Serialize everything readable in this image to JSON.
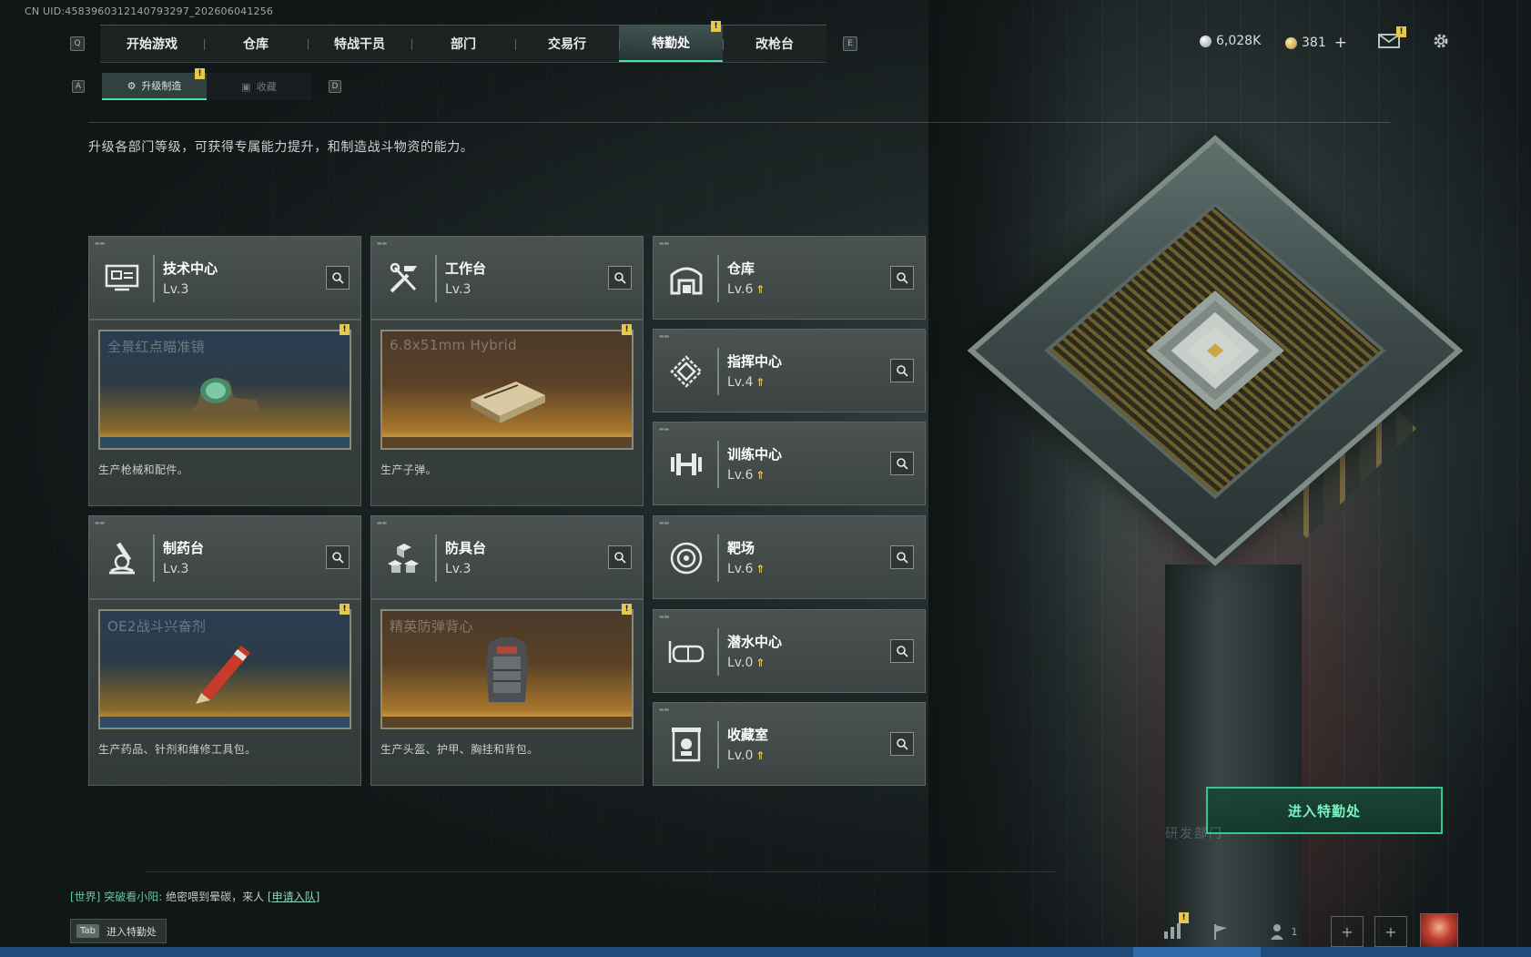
{
  "uid": "CN UID:4583960312140793297_202606041256",
  "nav": {
    "tabs": [
      {
        "label": "开始游戏"
      },
      {
        "label": "仓库"
      },
      {
        "label": "特战干员"
      },
      {
        "label": "部门"
      },
      {
        "label": "交易行"
      },
      {
        "label": "特勤处",
        "active": true,
        "badge": "!"
      },
      {
        "label": "改枪台"
      }
    ],
    "left_key": "Q",
    "right_key": "E"
  },
  "subnav": {
    "left_key": "A",
    "right_key": "D",
    "tabs": [
      {
        "label": "升级制造",
        "active": true,
        "badge": "!"
      },
      {
        "label": "收藏",
        "active": false
      }
    ]
  },
  "description": "升级各部门等级，可获得专属能力提升，和制造战斗物资的能力。",
  "currency": {
    "silver": "6,028K",
    "gold": "381",
    "gold_add": "+",
    "mail_badge": "!"
  },
  "departments_left": [
    {
      "name": "技术中心",
      "level": "Lv.3",
      "icon": "tech-center-icon",
      "preview_title": "全景红点瞄准镜",
      "preview_badge": "!",
      "preview_color": "blue",
      "desc": "生产枪械和配件。"
    },
    {
      "name": "工作台",
      "level": "Lv.3",
      "icon": "workbench-icon",
      "preview_title": "6.8x51mm Hybrid",
      "preview_badge": "!",
      "preview_color": "brown",
      "desc": "生产子弹。"
    },
    {
      "name": "制药台",
      "level": "Lv.3",
      "icon": "pharmacy-icon",
      "preview_title": "OE2战斗兴奋剂",
      "preview_badge": "!",
      "preview_color": "blue",
      "desc": "生产药品、针剂和维修工具包。"
    },
    {
      "name": "防具台",
      "level": "Lv.3",
      "icon": "armor-bench-icon",
      "preview_title": "精英防弹背心",
      "preview_badge": "!",
      "preview_color": "brown",
      "desc": "生产头盔、护甲、胸挂和背包。"
    }
  ],
  "departments_right": [
    {
      "name": "仓库",
      "level": "Lv.6",
      "icon": "warehouse-icon",
      "upgradable": true
    },
    {
      "name": "指挥中心",
      "level": "Lv.4",
      "icon": "command-center-icon",
      "upgradable": true
    },
    {
      "name": "训练中心",
      "level": "Lv.6",
      "icon": "training-center-icon",
      "upgradable": true
    },
    {
      "name": "靶场",
      "level": "Lv.6",
      "icon": "shooting-range-icon",
      "upgradable": true
    },
    {
      "name": "潜水中心",
      "level": "Lv.0",
      "icon": "diving-center-icon",
      "upgradable": true
    },
    {
      "name": "收藏室",
      "level": "Lv.0",
      "icon": "collection-room-icon",
      "upgradable": true
    }
  ],
  "enter_button": "进入特勤处",
  "dept_label": "研发部门",
  "chat": {
    "channel": "[世界]",
    "sender": "突破看小阳:",
    "message": "绝密喂到晕碳，来人",
    "link": "[申请入队]"
  },
  "tab_hint": {
    "key": "Tab",
    "label": "进入特勤处"
  },
  "bottom": {
    "stats_badge": "!",
    "friends_count": "1"
  },
  "colors": {
    "accent": "#4fe0a8",
    "badge": "#e6c84a",
    "taskbar": "#1f4a7a"
  }
}
